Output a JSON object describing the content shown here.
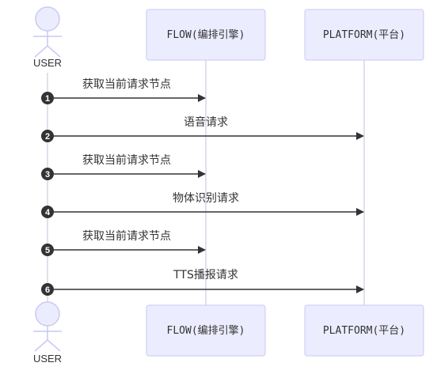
{
  "participants": {
    "user": {
      "label": "USER"
    },
    "flow": {
      "label": "FLOW(编排引擎)"
    },
    "platform": {
      "label": "PLATFORM(平台)"
    }
  },
  "messages": [
    {
      "seq": "1",
      "text": "获取当前请求节点",
      "from": "user",
      "to": "flow"
    },
    {
      "seq": "2",
      "text": "语音请求",
      "from": "user",
      "to": "platform"
    },
    {
      "seq": "3",
      "text": "获取当前请求节点",
      "from": "user",
      "to": "flow"
    },
    {
      "seq": "4",
      "text": "物体识别请求",
      "from": "user",
      "to": "platform"
    },
    {
      "seq": "5",
      "text": "获取当前请求节点",
      "from": "user",
      "to": "flow"
    },
    {
      "seq": "6",
      "text": "TTS播报请求",
      "from": "user",
      "to": "platform"
    }
  ],
  "colors": {
    "box_fill": "#ececff",
    "box_stroke": "#c9c9f5",
    "lifeline": "#c3c3d8",
    "arrow": "#333333",
    "seq_fill": "#333333"
  }
}
